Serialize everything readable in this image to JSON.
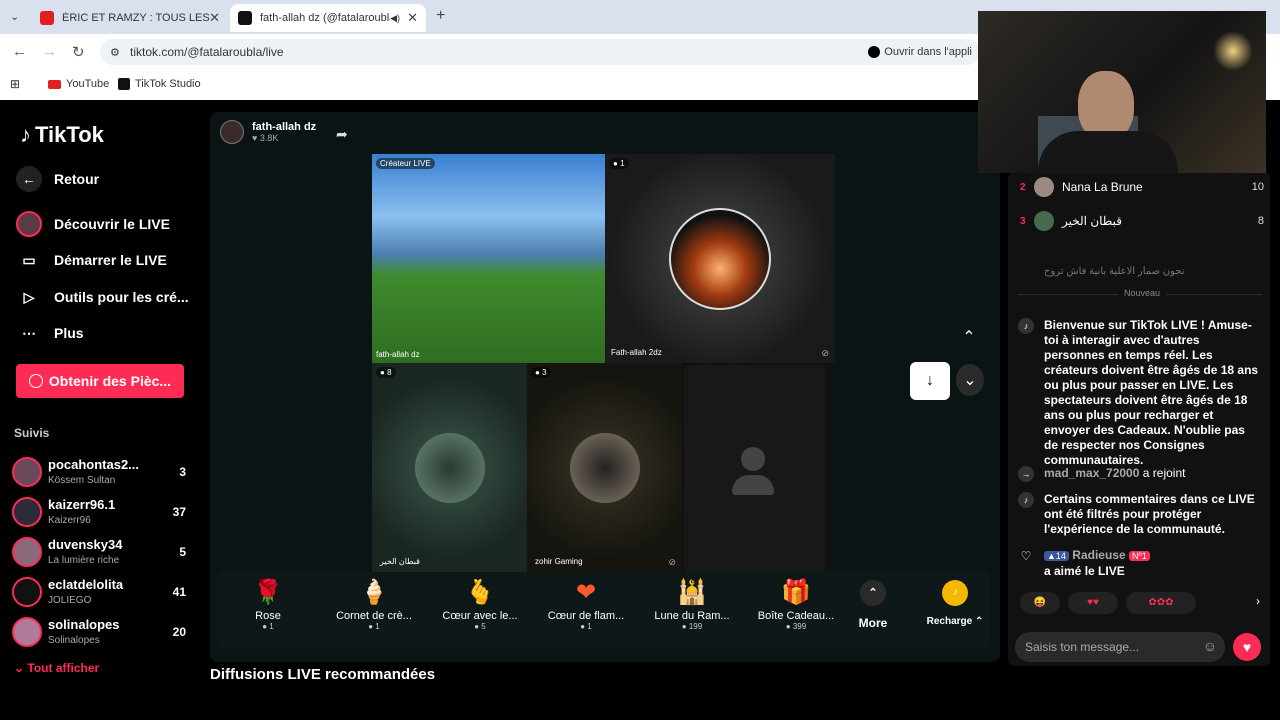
{
  "browser": {
    "tabs": [
      {
        "title": "ÉRIC ET RAMZY : TOUS LES SUJ",
        "close": "✕"
      },
      {
        "title": "fath-allah dz (@fatalaroubla",
        "close": "✕"
      }
    ],
    "new_tab": "+",
    "url": "tiktok.com/@fatalaroubla/live",
    "open_app": "Ouvrir dans l'appli",
    "bookmarks": [
      "YouTube",
      "TikTok Studio"
    ]
  },
  "sidebar": {
    "logo": "TikTok",
    "items": [
      {
        "label": "Retour"
      },
      {
        "label": "Découvrir le LIVE"
      },
      {
        "label": "Démarrer le LIVE"
      },
      {
        "label": "Outils pour les cré..."
      },
      {
        "label": "Plus"
      }
    ],
    "coins_button": "Obtenir des Pièc...",
    "following_title": "Suivis",
    "following": [
      {
        "name": "pocahontas2...",
        "sub": "Kössem Sultan",
        "count": "3"
      },
      {
        "name": "kaizerr96.1",
        "sub": "Kaizerr96",
        "count": "37"
      },
      {
        "name": "duvensky34",
        "sub": "La lumière riche",
        "count": "5"
      },
      {
        "name": "eclatdelolita",
        "sub": "JOLIEGO",
        "count": "41"
      },
      {
        "name": "solinalopes",
        "sub": "Solinalopes",
        "count": "20"
      }
    ],
    "show_all": "Tout afficher"
  },
  "live": {
    "host_name": "fath-allah dz",
    "host_likes": "3.8K",
    "cells": [
      {
        "badge": "Créateur LIVE",
        "name": "fath-allah dz"
      },
      {
        "badge": "1",
        "name": "Fath-allah 2dz"
      },
      {
        "badge": "8",
        "name": "قبطان الخير"
      },
      {
        "badge": "3",
        "name": "zohir Gaming"
      },
      {
        "badge": "",
        "name": ""
      }
    ],
    "gifts": [
      {
        "name": "Rose",
        "price": "1",
        "icon": "🌹"
      },
      {
        "name": "Cornet de crè...",
        "price": "1",
        "icon": "🍦"
      },
      {
        "name": "Cœur avec le...",
        "price": "5",
        "icon": "🫰"
      },
      {
        "name": "Cœur de flam...",
        "price": "1",
        "icon": "❤"
      },
      {
        "name": "Lune du Ram...",
        "price": "199",
        "icon": "🕌"
      },
      {
        "name": "Boîte Cadeau...",
        "price": "399",
        "icon": "🎁"
      }
    ],
    "more": "More",
    "recharge": "Recharge"
  },
  "recommended_title": "Diffusions LIVE recommandées",
  "chat": {
    "ranks": [
      {
        "n": "2",
        "name": "Nana La Brune",
        "count": "10"
      },
      {
        "n": "3",
        "name": "قبطان الخير",
        "count": "8"
      }
    ],
    "filtered": "نجون صمار الاعلية بانية فاش تروح",
    "new_label": "Nouveau",
    "welcome": "Bienvenue sur TikTok LIVE ! Amuse-toi à interagir avec d'autres personnes en temps réel. Les créateurs doivent être âgés de 18 ans ou plus pour passer en LIVE. Les spectateurs doivent être âgés de 18 ans ou plus pour recharger et envoyer des Cadeaux. N'oublie pas de respecter nos Consignes communautaires.",
    "join_user": "mad_max_72000",
    "join_text": "a rejoint",
    "filter_msg": "Certains commentaires dans ce LIVE ont été filtrés pour protéger l'expérience de la communauté.",
    "liker_level": "14",
    "liker": "Radieuse",
    "liker_badge": "Nº1",
    "liked": "a aimé le LIVE",
    "placeholder": "Saisis ton message..."
  }
}
